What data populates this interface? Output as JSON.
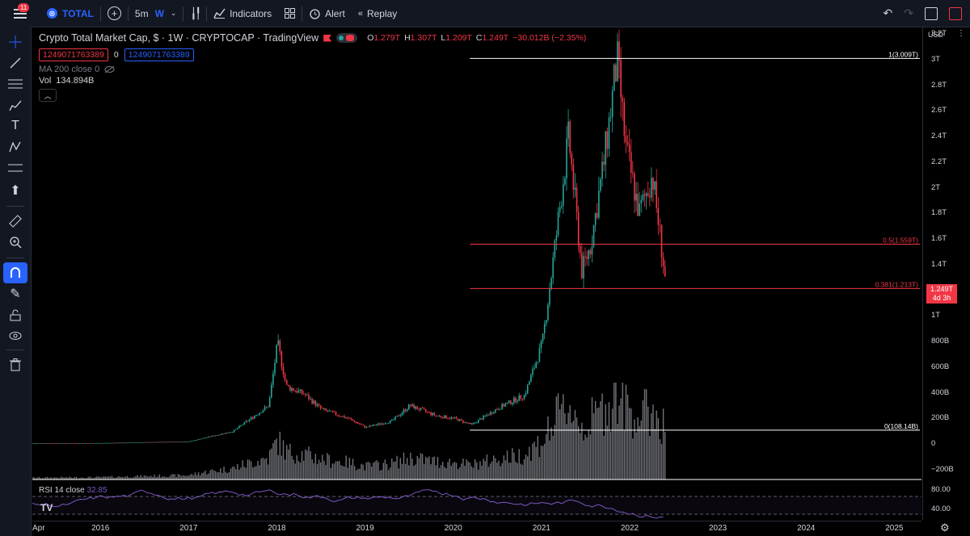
{
  "topbar": {
    "notification_count": "11",
    "symbol": "TOTAL",
    "interval_min": "5m",
    "interval_week": "W",
    "indicators_label": "Indicators",
    "alert_label": "Alert",
    "replay_label": "Replay"
  },
  "legend": {
    "title": "Crypto Total Market Cap, $ · 1W · CRYPTOCAP · TradingView",
    "o_label": "O",
    "o_value": "1.279T",
    "h_label": "H",
    "h_value": "1.307T",
    "l_label": "L",
    "l_value": "1.209T",
    "c_label": "C",
    "c_value": "1.249T",
    "change": "−30.012B (−2.35%)",
    "sell_price": "1249071763389",
    "spread": "0",
    "buy_price": "1249071763389",
    "ma_label": "MA 200 close 0",
    "vol_label": "Vol",
    "vol_value": "134.894B"
  },
  "fib": [
    {
      "label": "1(3.009T)",
      "value": 3.009
    },
    {
      "label": "0.5(1.559T)",
      "value": 1.559
    },
    {
      "label": "0.381(1.213T)",
      "value": 1.213
    },
    {
      "label": "0(108.14B)",
      "value": 0.10814
    }
  ],
  "price_scale": {
    "currency": "USD",
    "labels": [
      "3.2T",
      "3T",
      "2.8T",
      "2.6T",
      "2.4T",
      "2.2T",
      "2T",
      "1.8T",
      "1.6T",
      "1.4T",
      "1T",
      "800B",
      "600B",
      "400B",
      "200B",
      "0",
      "−200B"
    ],
    "current_price": "1.249T",
    "countdown": "4d 3h"
  },
  "rsi": {
    "label": "RSI 14 close",
    "value": "32.85",
    "levels": [
      "80.00",
      "40.00"
    ]
  },
  "time_axis": [
    "Apr",
    "2016",
    "2017",
    "2018",
    "2019",
    "2020",
    "2021",
    "2022",
    "2023",
    "2024",
    "2025"
  ],
  "colors": {
    "up": "#26a69a",
    "down": "#f23645",
    "accent": "#2962ff",
    "rsi": "#7e57c2",
    "fib_top": "#ffffff",
    "fib_mid": "#f23645"
  },
  "chart_data": {
    "type": "line",
    "title": "Crypto Total Market Cap, $ · 1W · CRYPTOCAP · TradingView",
    "x": [
      2015.2,
      2016.0,
      2017.0,
      2017.5,
      2017.9,
      2018.0,
      2018.1,
      2018.3,
      2018.5,
      2018.8,
      2019.0,
      2019.3,
      2019.5,
      2019.8,
      2020.0,
      2020.2,
      2020.5,
      2020.8,
      2021.0,
      2021.1,
      2021.3,
      2021.45,
      2021.55,
      2021.7,
      2021.85,
      2021.95,
      2022.1,
      2022.25,
      2022.35,
      2022.4
    ],
    "series": [
      {
        "values": [
          0.005,
          0.007,
          0.02,
          0.1,
          0.3,
          0.79,
          0.45,
          0.39,
          0.27,
          0.2,
          0.13,
          0.18,
          0.3,
          0.22,
          0.2,
          0.15,
          0.28,
          0.38,
          0.78,
          1.3,
          2.4,
          1.35,
          1.55,
          2.2,
          3.0,
          2.3,
          1.8,
          2.1,
          1.55,
          1.249
        ]
      }
    ],
    "ylim": [
      -0.25,
      3.3
    ]
  }
}
